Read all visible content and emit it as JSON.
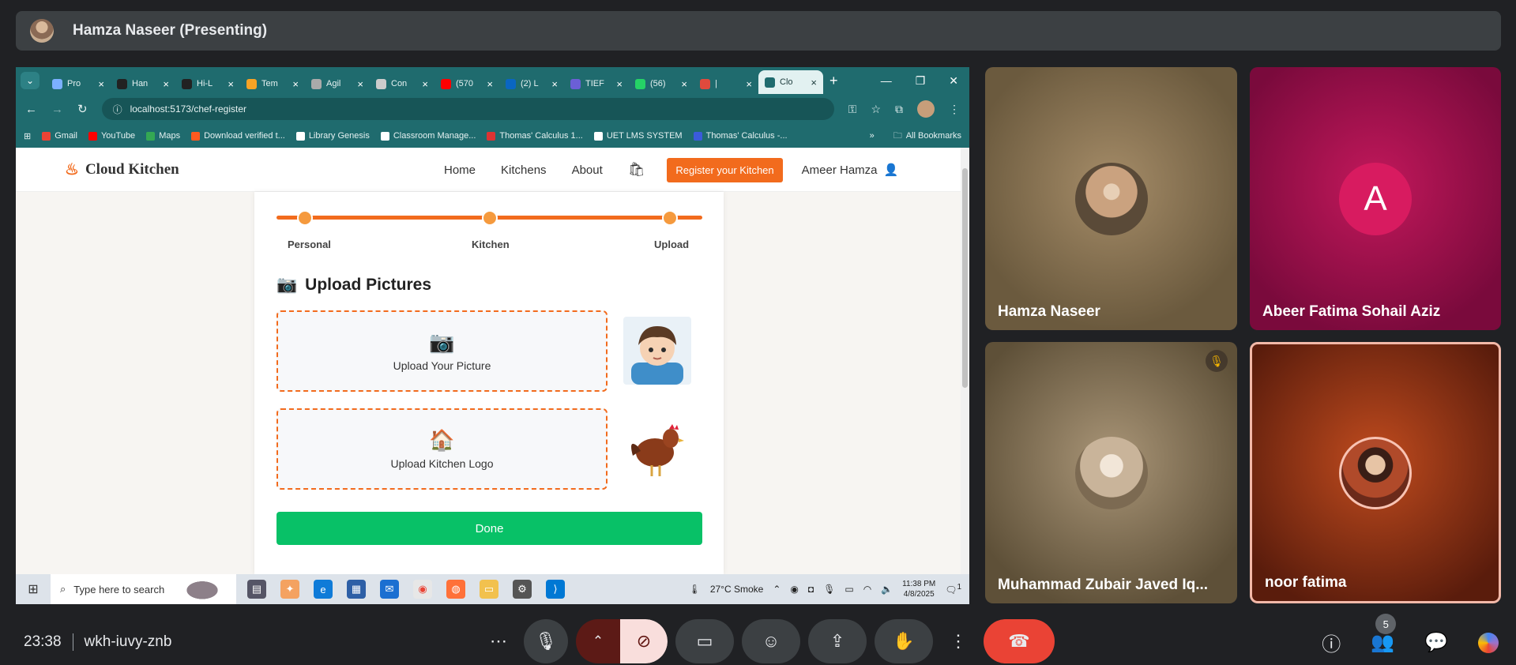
{
  "presenter": {
    "name": "Hamza Naseer (Presenting)"
  },
  "browser": {
    "tabs": [
      {
        "label": "Pro",
        "color": "#7bb0ff"
      },
      {
        "label": "Han",
        "color": "#222"
      },
      {
        "label": "Hi-L",
        "color": "#222"
      },
      {
        "label": "Tem",
        "color": "#f7a325"
      },
      {
        "label": "Agil",
        "color": "#aaaaaa"
      },
      {
        "label": "Con",
        "color": "#cccccc"
      },
      {
        "label": "(570",
        "color": "#ff0000"
      },
      {
        "label": "(2) L",
        "color": "#0a66c2"
      },
      {
        "label": "TIEF",
        "color": "#6b5fd6"
      },
      {
        "label": "(56)",
        "color": "#25d366"
      },
      {
        "label": "|",
        "color": "#e04a3d"
      },
      {
        "label": "Clo",
        "color": "#1f6b6e",
        "active": true
      }
    ],
    "url": "localhost:5173/chef-register",
    "bookmarks": [
      {
        "label": "Gmail",
        "color": "#ea4335"
      },
      {
        "label": "YouTube",
        "color": "#ff0000"
      },
      {
        "label": "Maps",
        "color": "#34a853"
      },
      {
        "label": "Download verified t...",
        "color": "#ff5a1f"
      },
      {
        "label": "Library Genesis",
        "color": "#ffffff"
      },
      {
        "label": "Classroom Manage...",
        "color": "#ffffff"
      },
      {
        "label": "Thomas' Calculus 1...",
        "color": "#d33"
      },
      {
        "label": "UET LMS SYSTEM",
        "color": "#ffffff"
      },
      {
        "label": "Thomas' Calculus -...",
        "color": "#3b5bdb"
      }
    ],
    "all_bookmarks": "All Bookmarks"
  },
  "site": {
    "brand": "Cloud Kitchen",
    "nav": [
      "Home",
      "Kitchens",
      "About"
    ],
    "register_btn": "Register your Kitchen",
    "user": "Ameer Hamza",
    "steps": [
      "Personal",
      "Kitchen",
      "Upload"
    ],
    "section_title": "Upload Pictures",
    "upload_picture": "Upload Your Picture",
    "upload_logo": "Upload Kitchen Logo",
    "done": "Done"
  },
  "taskbar": {
    "search_placeholder": "Type here to search",
    "weather": "27°C  Smoke",
    "time": "11:38 PM",
    "date": "4/8/2025",
    "notif_count": "1"
  },
  "participants": [
    {
      "name": "Hamza Naseer"
    },
    {
      "name": "Abeer Fatima Sohail Aziz",
      "initial": "A"
    },
    {
      "name": "Muhammad Zubair Javed Iq...",
      "muted": true
    },
    {
      "name": "noor fatima"
    }
  ],
  "meeting": {
    "time": "23:38",
    "code": "wkh-iuvy-znb",
    "people_count": "5"
  }
}
